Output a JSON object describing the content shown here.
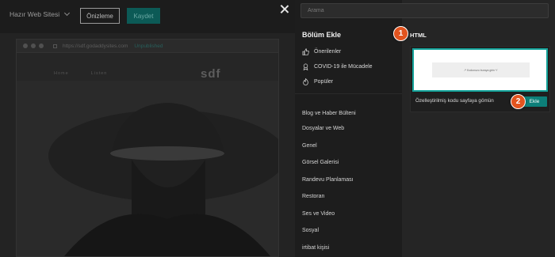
{
  "topbar": {
    "site_select": "Hazır Web Sitesi",
    "preview_button": "Önizleme",
    "save_button": "Kaydet"
  },
  "browser": {
    "url": "https://sdf.godaddysites.com",
    "unpublished": "Unpublished",
    "nav": [
      "Home",
      "Listen"
    ],
    "site_title": "sdf"
  },
  "panel": {
    "search_placeholder": "Arama",
    "title": "Bölüm Ekle",
    "featured": [
      {
        "label": "Önerilenler",
        "icon": "thumbs-up-icon"
      },
      {
        "label": "COVID-19 ile Mücadele",
        "icon": "ribbon-icon"
      },
      {
        "label": "Popüler",
        "icon": "flame-icon"
      }
    ],
    "categories": [
      "Blog ve Haber Bülteni",
      "Dosyalar ve Web",
      "Genel",
      "Görsel Galerisi",
      "Randevu Planlaması",
      "Restoran",
      "Ses ve Video",
      "Sosyal",
      "irtibat kişisi"
    ],
    "section_heading": "HTML",
    "card": {
      "preview_text": "/* Kodunuzu buraya girin */",
      "description": "Özelleştirilmiş kodu sayfaya gömün",
      "add_button": "Ekle"
    }
  },
  "badges": [
    "1",
    "2"
  ],
  "colors": {
    "accent": "#0d7f79",
    "badge": "#e2541f"
  }
}
